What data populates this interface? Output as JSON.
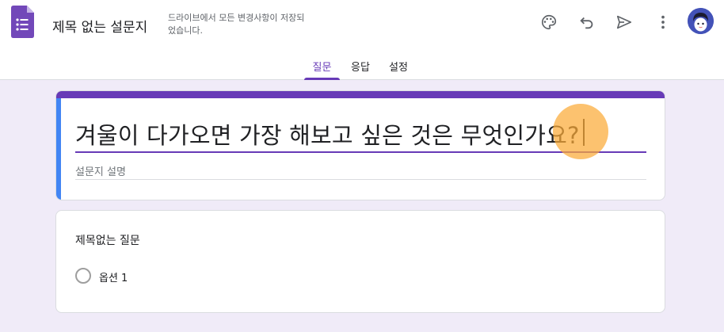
{
  "header": {
    "doc_title": "제목 없는 설문지",
    "save_status": "드라이브에서 모든 변경사항이 저장되었습니다.",
    "icons": [
      "forms-icon",
      "palette-icon",
      "undo-icon",
      "send-icon",
      "more-vert-icon",
      "avatar"
    ]
  },
  "tabs": [
    {
      "label": "질문",
      "active": true
    },
    {
      "label": "응답",
      "active": false
    },
    {
      "label": "설정",
      "active": false
    }
  ],
  "form": {
    "title": "겨울이 다가오면 가장 해보고 싶은 것은 무엇인가요?",
    "description_placeholder": "설문지 설명"
  },
  "question": {
    "title": "제목없는 질문",
    "options": [
      "옵션 1"
    ]
  },
  "colors": {
    "accent": "#673ab7",
    "background": "#f0ebf8",
    "focus": "#4285f4",
    "click_marker": "#fbaa38"
  }
}
